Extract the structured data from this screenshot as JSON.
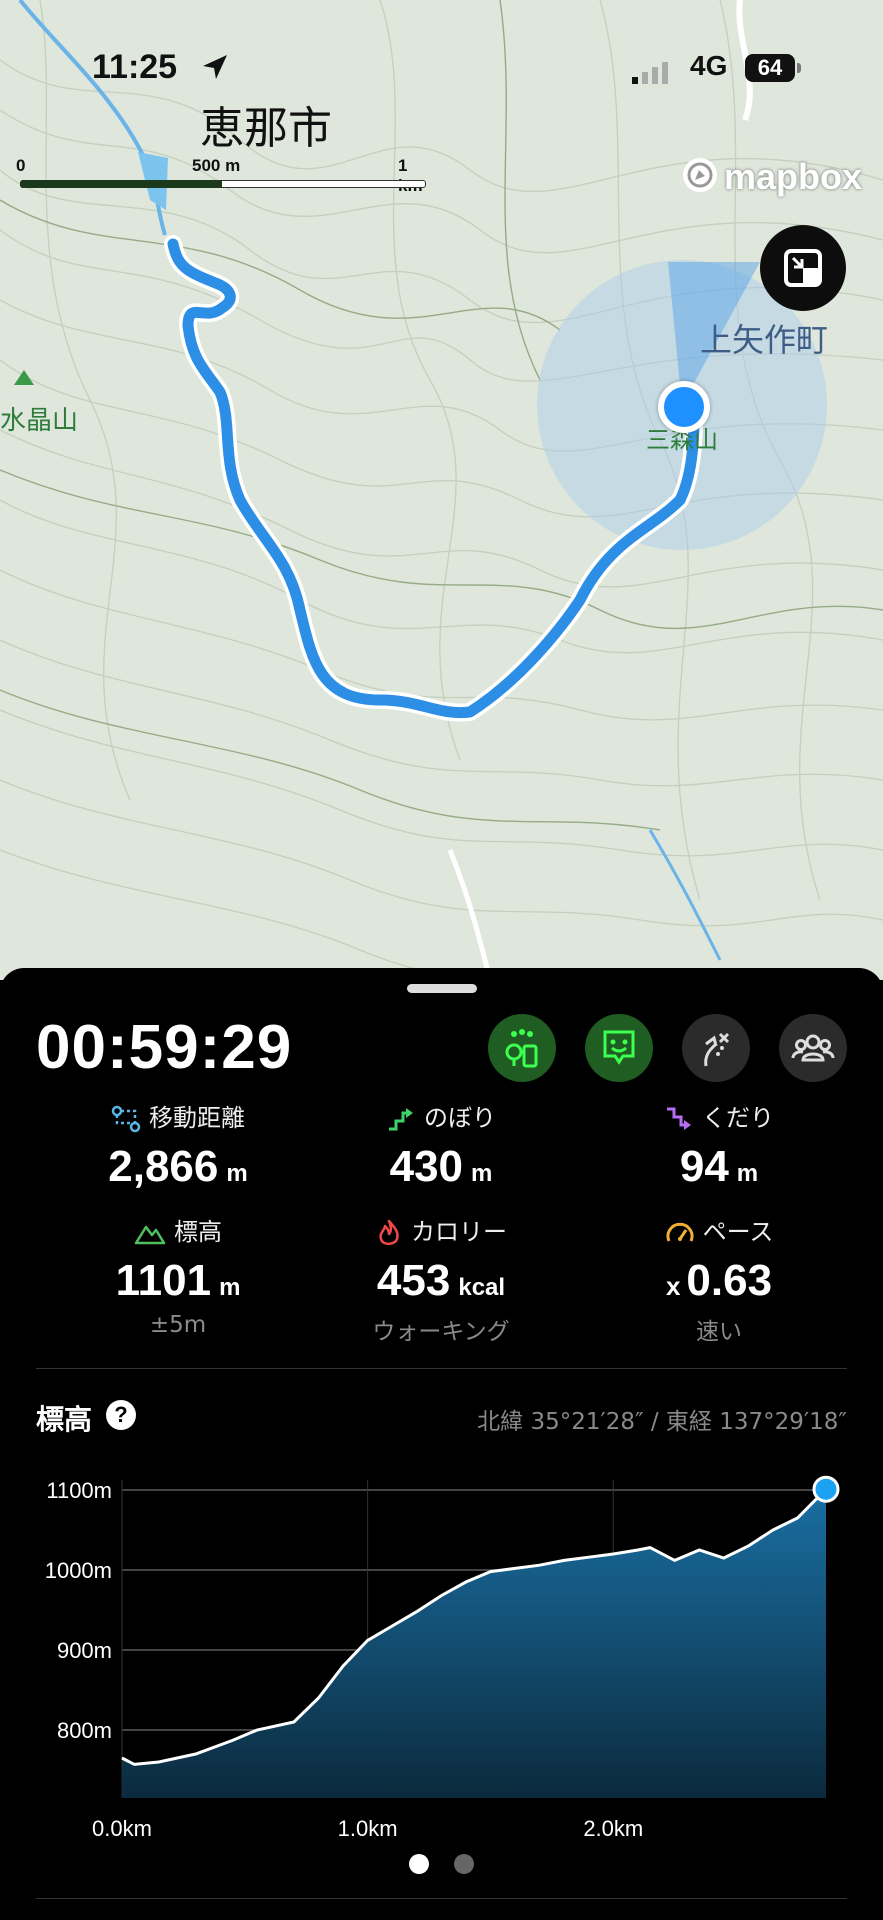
{
  "status_bar": {
    "time": "11:25",
    "network": "4G",
    "battery": "64"
  },
  "map": {
    "city_label": "恵那市",
    "scale": {
      "zero": "0",
      "mid": "500 m",
      "end": "1 km"
    },
    "attribution": "mapbox",
    "labels": {
      "left_peak": "水晶山",
      "town": "上矢作町",
      "summit": "三森山"
    },
    "fullscreen_icon": "collapse-icon"
  },
  "tracking": {
    "elapsed": "00:59:29",
    "controls": [
      "map-marker-icon",
      "face-icon",
      "route-icon",
      "group-icon"
    ],
    "stats": [
      {
        "label": "移動距離",
        "value": "2,866",
        "unit": "m",
        "sub": ""
      },
      {
        "label": "のぼり",
        "value": "430",
        "unit": "m",
        "sub": ""
      },
      {
        "label": "くだり",
        "value": "94",
        "unit": "m",
        "sub": ""
      },
      {
        "label": "標高",
        "value": "1101",
        "unit": "m",
        "sub": "±5m"
      },
      {
        "label": "カロリー",
        "value": "453",
        "unit": "kcal",
        "sub": "ウォーキング"
      },
      {
        "label": "ペース",
        "prefix": "x",
        "value": "0.63",
        "unit": "",
        "sub": "速い"
      }
    ]
  },
  "elevation": {
    "title": "標高",
    "help": "?",
    "coordinates": "北緯 35°21′28″ / 東経 137°29′18″"
  },
  "chart_data": {
    "type": "area",
    "title": "標高",
    "y_ticks": [
      "1100m",
      "1000m",
      "900m",
      "800m"
    ],
    "x_ticks": [
      "0.0km",
      "1.0km",
      "2.0km"
    ],
    "xlim": [
      0,
      2.866
    ],
    "ylim": [
      770,
      1100
    ],
    "x": [
      0,
      0.05,
      0.15,
      0.3,
      0.45,
      0.55,
      0.7,
      0.8,
      0.9,
      1.0,
      1.1,
      1.2,
      1.3,
      1.4,
      1.5,
      1.6,
      1.7,
      1.8,
      1.9,
      2.0,
      2.1,
      2.15,
      2.25,
      2.35,
      2.45,
      2.55,
      2.65,
      2.75,
      2.866
    ],
    "y": [
      765,
      757,
      760,
      770,
      787,
      800,
      810,
      840,
      880,
      912,
      930,
      948,
      968,
      985,
      998,
      1002,
      1006,
      1012,
      1016,
      1020,
      1025,
      1028,
      1012,
      1025,
      1015,
      1030,
      1050,
      1065,
      1101
    ],
    "colors": {
      "fill_top": "#1a6fa3",
      "fill_bottom": "#0b2a3d",
      "line": "#ffffff",
      "marker": "#1da1f2"
    }
  },
  "pager": {
    "pages": 2,
    "active": 0
  }
}
